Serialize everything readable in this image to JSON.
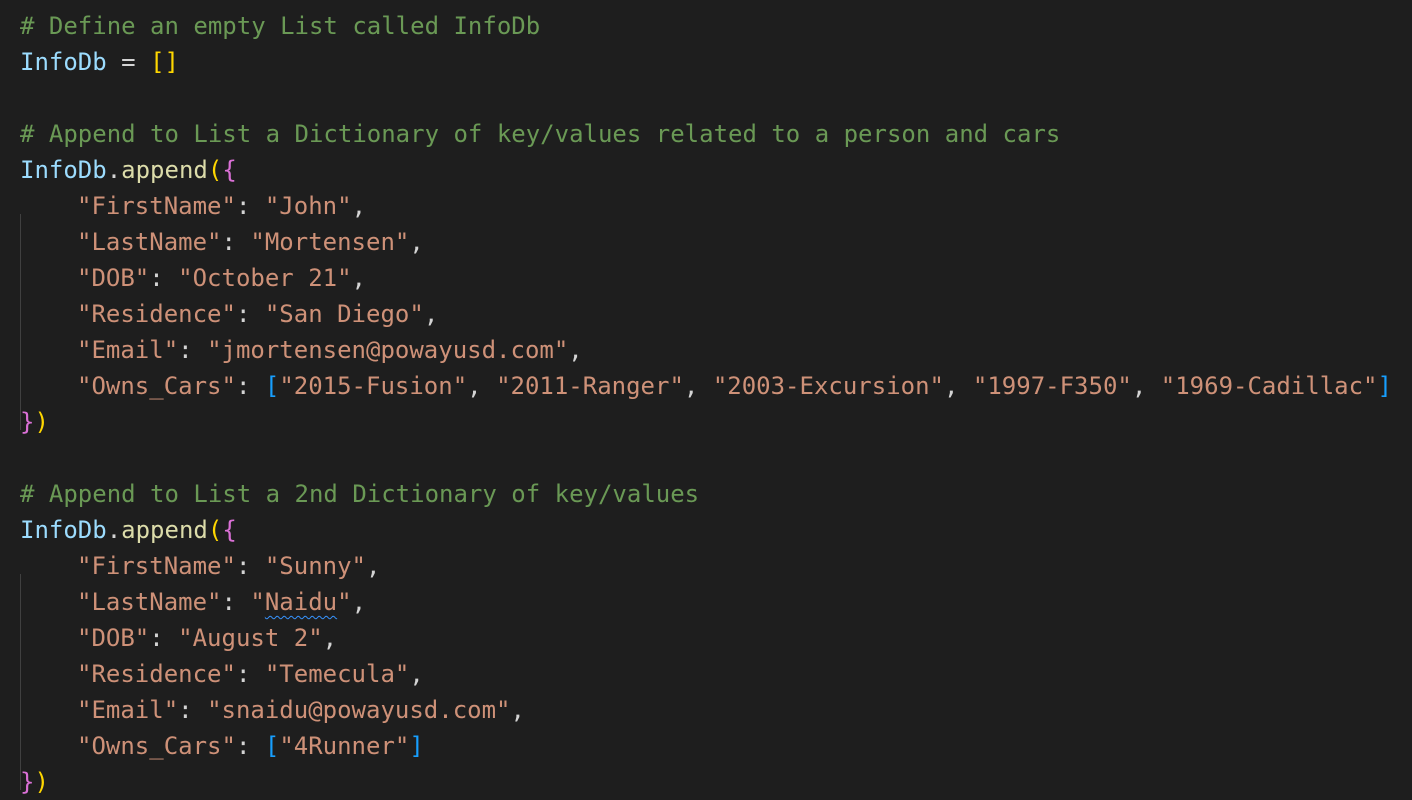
{
  "editor": {
    "comments": {
      "c1": "# Define an empty List called InfoDb",
      "c2": "# Append to List a Dictionary of key/values related to a person and cars",
      "c3": "# Append to List a 2nd Dictionary of key/values"
    },
    "tokens": {
      "var_name": "InfoDb",
      "dot": ".",
      "method": "append",
      "assign": " = ",
      "empty_list": "[]",
      "open_paren": "(",
      "close_paren": ")",
      "open_brace": "{",
      "close_brace": "}",
      "colon": ": ",
      "comma": ",",
      "list_sep": ", ",
      "open_bracket": "[",
      "close_bracket": "]",
      "quote": "\""
    },
    "records": [
      {
        "keys": {
          "first": "\"FirstName\"",
          "last": "\"LastName\"",
          "dob": "\"DOB\"",
          "res": "\"Residence\"",
          "email": "\"Email\"",
          "cars": "\"Owns_Cars\""
        },
        "values": {
          "first": "\"John\"",
          "last": "\"Mortensen\"",
          "dob": "\"October 21\"",
          "res": "\"San Diego\"",
          "email": "\"jmortensen@powayusd.com\""
        },
        "cars": [
          "\"2015-Fusion\"",
          "\"2011-Ranger\"",
          "\"2003-Excursion\"",
          "\"1997-F350\"",
          "\"1969-Cadillac\""
        ]
      },
      {
        "keys": {
          "first": "\"FirstName\"",
          "last": "\"LastName\"",
          "dob": "\"DOB\"",
          "res": "\"Residence\"",
          "email": "\"Email\"",
          "cars": "\"Owns_Cars\""
        },
        "values": {
          "first": "\"Sunny\"",
          "last_word": "Naidu",
          "dob": "\"August 2\"",
          "res": "\"Temecula\"",
          "email": "\"snaidu@powayusd.com\""
        },
        "cars": [
          "\"4Runner\""
        ]
      }
    ]
  }
}
